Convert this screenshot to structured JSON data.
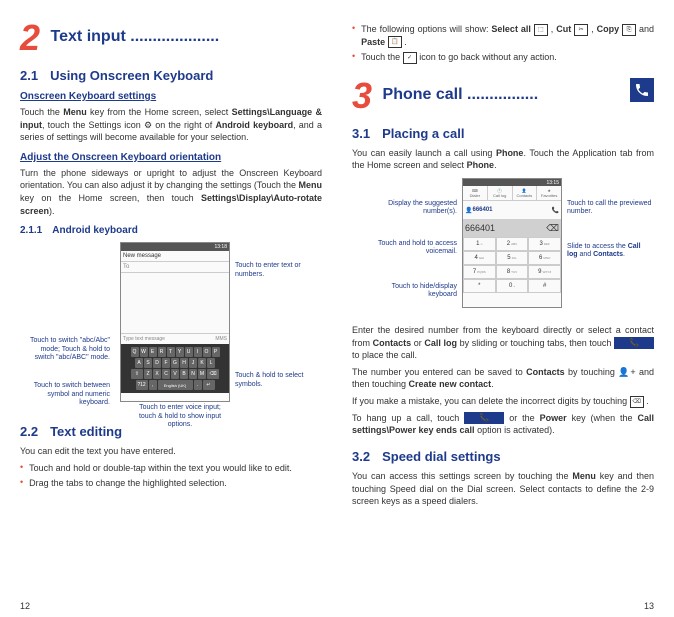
{
  "left": {
    "chapter_num": "2",
    "chapter_title": "Text input ....................",
    "s21_num": "2.1",
    "s21_title": "Using Onscreen Keyboard",
    "s21_h3a": "Onscreen Keyboard settings",
    "s21_p1": "Touch the Menu key from the Home screen, select Settings\\Language & input, touch the Settings icon ⚙ on the right of Android keyboard, and a series of settings will become available for your selection.",
    "s21_h3b": "Adjust the Onscreen Keyboard orientation",
    "s21_p2": "Turn the phone sideways or upright to adjust the Onscreen Keyboard orientation. You can also adjust it by changing the settings (Touch the Menu key on the Home screen, then touch Settings\\Display\\Auto-rotate screen).",
    "s211_num": "2.1.1",
    "s211_title": "Android keyboard",
    "kb": {
      "status_time": "13:18",
      "title": "New message",
      "to": "To",
      "input": "Type text message",
      "mms": "MMS",
      "row1": [
        "Q",
        "W",
        "E",
        "R",
        "T",
        "Y",
        "U",
        "I",
        "O",
        "P"
      ],
      "row2": [
        "A",
        "S",
        "D",
        "F",
        "G",
        "H",
        "J",
        "K",
        "L"
      ],
      "row3_shift": "⇧",
      "row3": [
        "Z",
        "X",
        "C",
        "V",
        "B",
        "N",
        "M"
      ],
      "row3_del": "⌫",
      "space": "English (UK)",
      "c_enter": "Touch to enter text or numbers.",
      "c_switch_abc": "Touch to switch \"abc/Abc\" mode; Touch & hold to switch \"abc/ABC\" mode.",
      "c_switch_num": "Touch to switch between symbol and numeric keyboard.",
      "c_voice": "Touch to enter voice input; touch & hold to show input options.",
      "c_symbols": "Touch & hold to select symbols."
    },
    "s22_num": "2.2",
    "s22_title": "Text editing",
    "s22_p1": "You can edit the text you have entered.",
    "s22_b1": "Touch and hold or double-tap within the text you would like to edit.",
    "s22_b2": "Drag the tabs to change the highlighted selection.",
    "page_num": "12"
  },
  "right": {
    "b1": "The following options will show: Select all ⬚ , Cut ✂ , Copy ⎘ and Paste 📋 .",
    "b2": "Touch the ✓ icon to go back without any action.",
    "chapter_num": "3",
    "chapter_title": "Phone call ................",
    "s31_num": "3.1",
    "s31_title": "Placing a call",
    "s31_p1": "You can easily launch a call using Phone. Touch the Application tab from the Home screen and select Phone.",
    "dial": {
      "status_time": "13:15",
      "tabs": [
        "Dialer",
        "Call log",
        "Contacts",
        "Favorites"
      ],
      "suggest_num": "666401",
      "entry": "666401",
      "pad": [
        [
          "1",
          "2 ABC",
          "3 DEF"
        ],
        [
          "4 GHI",
          "5 JKL",
          "6 MNO"
        ],
        [
          "7 PQRS",
          "8 TUV",
          "9 WXYZ"
        ],
        [
          "*",
          "0 +",
          "#"
        ]
      ],
      "c_display": "Display the suggested number(s).",
      "c_callprev": "Touch to call the previewed number.",
      "c_voicemail": "Touch and hold to access voicemail.",
      "c_slide": "Slide to access the Call log and Contacts.",
      "c_hide": "Touch to hide/display keyboard"
    },
    "s31_p2": "Enter the desired number from the keyboard directly or select a contact from Contacts or Call log by sliding or touching tabs, then touch 📞 to place the call.",
    "s31_p3": "The number you entered can be saved to Contacts by touching 👤+ and then touching Create new contact.",
    "s31_p4": "If you make a mistake, you can delete the incorrect digits by touching ⌫ .",
    "s31_p5": "To hang up a call, touch 📞 or the Power key (when the Call settings\\Power key ends call option is activated).",
    "s32_num": "3.2",
    "s32_title": "Speed dial settings",
    "s32_p1": "You can access this settings screen by touching the Menu key and then touching Speed dial on the Dial screen. Select contacts to define the 2-9 screen keys as a speed dialers.",
    "page_num": "13"
  }
}
